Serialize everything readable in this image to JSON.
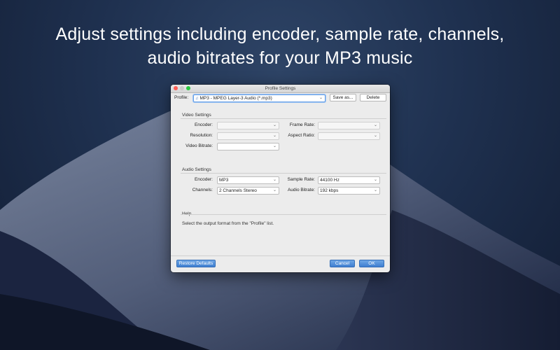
{
  "headline": {
    "line1": "Adjust settings including encoder, sample rate, channels,",
    "line2": "audio bitrates for your MP3 music"
  },
  "window": {
    "title": "Profile Settings"
  },
  "profile": {
    "label": "Profile:",
    "value": "MP3 - MPEG Layer-3 Audio (*.mp3)",
    "icon": "music-file-icon",
    "save_as": "Save as...",
    "delete": "Delete"
  },
  "video_settings": {
    "title": "Video Settings",
    "encoder_label": "Encoder:",
    "encoder_value": "",
    "frame_rate_label": "Frame Rate:",
    "frame_rate_value": "",
    "resolution_label": "Resolution:",
    "resolution_value": "",
    "aspect_ratio_label": "Aspect Ratio:",
    "aspect_ratio_value": "",
    "video_bitrate_label": "Video Bitrate:",
    "video_bitrate_value": ""
  },
  "audio_settings": {
    "title": "Audio Settings",
    "encoder_label": "Encoder:",
    "encoder_value": "MP3",
    "sample_rate_label": "Sample Rate:",
    "sample_rate_value": "44100 Hz",
    "channels_label": "Channels:",
    "channels_value": "2 Channels Stereo",
    "audio_bitrate_label": "Audio Bitrate:",
    "audio_bitrate_value": "192 kbps"
  },
  "help": {
    "title": "Help",
    "text": "Select the output format from the \"Profile\" list."
  },
  "footer": {
    "restore_defaults": "Restore Defaults",
    "cancel": "Cancel",
    "ok": "OK"
  },
  "colors": {
    "accent_blue": "#4a86d4",
    "window_bg": "#ececec",
    "desktop_bg": "#1f3150"
  }
}
